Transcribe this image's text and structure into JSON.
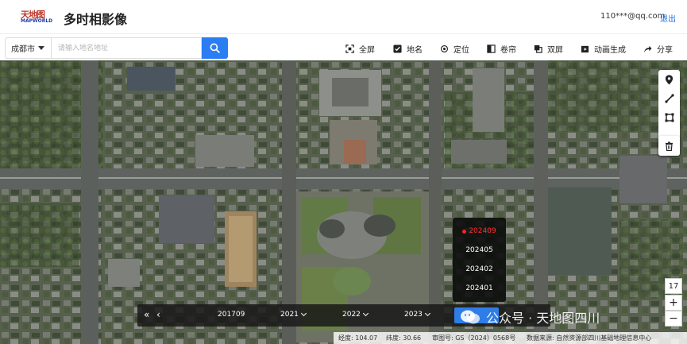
{
  "header": {
    "logo_text": "天地图",
    "logo_sub": "MAPWORLD",
    "title": "多时相影像",
    "user_email": "110***@qq.com",
    "logout_label": "退出"
  },
  "toolbar": {
    "city": "成都市",
    "search_placeholder": "请输入地名地址",
    "search_value": "",
    "tools": [
      {
        "label": "全屏",
        "icon": "fullscreen-icon"
      },
      {
        "label": "地名",
        "icon": "checkbox-checked-icon"
      },
      {
        "label": "定位",
        "icon": "locate-icon"
      },
      {
        "label": "卷帘",
        "icon": "swipe-icon"
      },
      {
        "label": "双屏",
        "icon": "dual-screen-icon"
      },
      {
        "label": "动画生成",
        "icon": "animation-icon"
      },
      {
        "label": "分享",
        "icon": "share-icon"
      }
    ]
  },
  "map_tools": [
    "marker-icon",
    "polyline-icon",
    "polygon-icon",
    "trash-icon"
  ],
  "zoom": {
    "level": "17",
    "in_label": "+",
    "out_label": "−"
  },
  "date_popup": {
    "items": [
      "202409",
      "202405",
      "202402",
      "202401"
    ],
    "active_index": 0
  },
  "timeline": {
    "prev_all": "«",
    "prev": "‹",
    "items": [
      "201709",
      "2021",
      "2022",
      "2023"
    ],
    "active": ""
  },
  "watermark": "公众号 · 天地图四川",
  "statusbar": {
    "lon": "经度: 104.07",
    "lat": "纬度: 30.66",
    "review": "审图号: GS（2024）0568号",
    "source": "数据来源: 自然资源部四川基础地理信息中心"
  },
  "colors": {
    "accent": "#2a7df2",
    "active_date": "#ff3030"
  }
}
